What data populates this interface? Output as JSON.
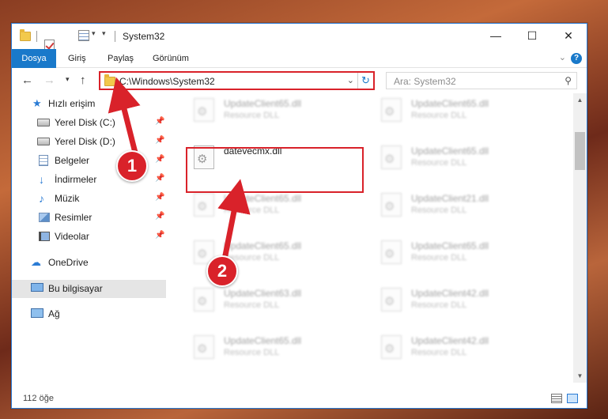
{
  "window": {
    "title": "System32"
  },
  "ribbon": {
    "tabs": [
      "Dosya",
      "Giriş",
      "Paylaş",
      "Görünüm"
    ]
  },
  "nav": {
    "address_path": "C:\\Windows\\System32",
    "search_placeholder": "Ara: System32"
  },
  "sidebar": {
    "items": [
      {
        "label": "Hızlı erişim",
        "icon": "star-icon"
      },
      {
        "label": "Yerel Disk (C:)",
        "icon": "drive-icon"
      },
      {
        "label": "Yerel Disk (D:)",
        "icon": "drive-icon"
      },
      {
        "label": "Belgeler",
        "icon": "documents-icon"
      },
      {
        "label": "İndirmeler",
        "icon": "downloads-icon"
      },
      {
        "label": "Müzik",
        "icon": "music-icon"
      },
      {
        "label": "Resimler",
        "icon": "pictures-icon"
      },
      {
        "label": "Videolar",
        "icon": "videos-icon"
      },
      {
        "label": "OneDrive",
        "icon": "cloud-icon"
      },
      {
        "label": "Bu bilgisayar",
        "icon": "computer-icon",
        "selected": true
      },
      {
        "label": "Ağ",
        "icon": "network-icon"
      }
    ]
  },
  "files": [
    {
      "name": "UpdateClient65.dll",
      "type": "Resource DLL"
    },
    {
      "name": "UpdateClient65.dll",
      "type": "Resource DLL"
    },
    {
      "name": "datevecmx.dll",
      "type": "",
      "highlighted": true
    },
    {
      "name": "UpdateClient65.dll",
      "type": "Resource DLL"
    },
    {
      "name": "UpdateClient65.dll",
      "type": "Resource DLL"
    },
    {
      "name": "UpdateClient21.dll",
      "type": "Resource DLL"
    },
    {
      "name": "UpdateClient65.dll",
      "type": "Resource DLL"
    },
    {
      "name": "UpdateClient65.dll",
      "type": "Resource DLL"
    },
    {
      "name": "UpdateClient63.dll",
      "type": "Resource DLL"
    },
    {
      "name": "UpdateClient42.dll",
      "type": "Resource DLL"
    },
    {
      "name": "UpdateClient65.dll",
      "type": "Resource DLL"
    },
    {
      "name": "UpdateClient42.dll",
      "type": "Resource DLL"
    }
  ],
  "status": {
    "item_count": "112 öğe"
  },
  "callouts": [
    "1",
    "2"
  ],
  "colors": {
    "accent": "#1979ca",
    "highlight": "#d9222a"
  }
}
